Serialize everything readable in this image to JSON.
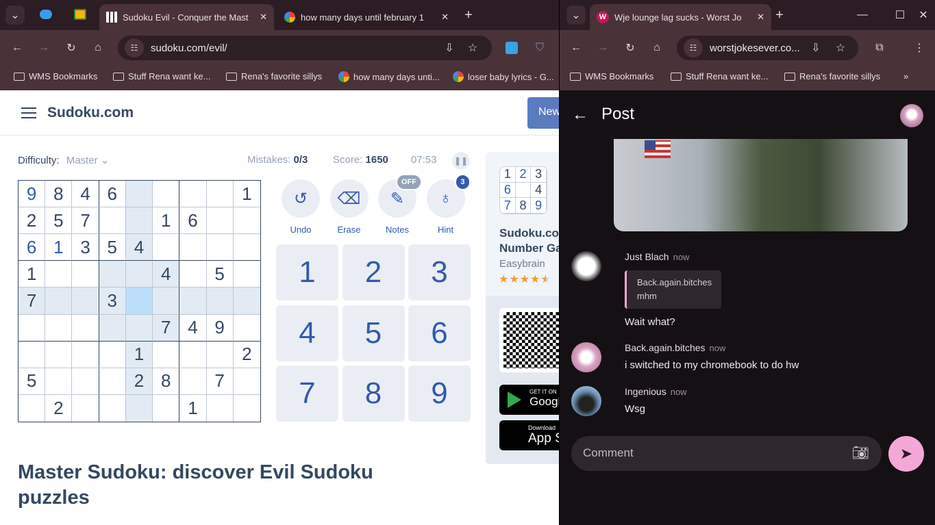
{
  "left_browser": {
    "tabs": [
      {
        "title": "Sudoku Evil - Conquer the Mast",
        "active": true
      },
      {
        "title": "how many days until february 1",
        "active": false
      }
    ],
    "url": "sudoku.com/evil/",
    "bookmarks": [
      "WMS Bookmarks",
      "Stuff Rena want ke...",
      "Rena's favorite sillys",
      "how many days unti...",
      "loser baby lyrics - G..."
    ]
  },
  "sudoku": {
    "logo": "Sudoku.com",
    "new_game": "New",
    "difficulty_label": "Difficulty:",
    "difficulty": "Master",
    "mistakes_label": "Mistakes:",
    "mistakes": "0/3",
    "score_label": "Score:",
    "score": "1650",
    "timer": "07:53",
    "grid": [
      [
        "9",
        "8",
        "4",
        "6",
        "",
        "",
        "",
        "",
        "1"
      ],
      [
        "2",
        "5",
        "7",
        "",
        "",
        "1",
        "6",
        "",
        ""
      ],
      [
        "6",
        "1",
        "3",
        "5",
        "4",
        "",
        "",
        "",
        ""
      ],
      [
        "1",
        "",
        "",
        "",
        "",
        "4",
        "",
        "5",
        ""
      ],
      [
        "7",
        "",
        "",
        "3",
        "",
        "",
        "",
        "",
        ""
      ],
      [
        "",
        "",
        "",
        "",
        "",
        "7",
        "4",
        "9",
        ""
      ],
      [
        "",
        "",
        "",
        "",
        "1",
        "",
        "",
        "",
        "2"
      ],
      [
        "5",
        "",
        "",
        "",
        "2",
        "8",
        "",
        "7",
        ""
      ],
      [
        "",
        "2",
        "",
        "",
        "",
        "",
        "1",
        "",
        ""
      ]
    ],
    "user_cells": [
      "0-0",
      "2-0",
      "2-1"
    ],
    "selected": "4-4",
    "actions": [
      {
        "label": "Undo",
        "icon": "undo-icon"
      },
      {
        "label": "Erase",
        "icon": "eraser-icon"
      },
      {
        "label": "Notes",
        "icon": "pencil-icon",
        "badge": "OFF"
      },
      {
        "label": "Hint",
        "icon": "lightbulb-icon",
        "badge": "3"
      }
    ],
    "numpad": [
      "1",
      "2",
      "3",
      "4",
      "5",
      "6",
      "7",
      "8",
      "9"
    ],
    "heading": "Master Sudoku: discover Evil Sudoku puzzles",
    "promo": {
      "icon_digits": [
        "1",
        "2",
        "3",
        "6",
        "",
        "4",
        "7",
        "8",
        "9"
      ],
      "title_line1": "Sudoku.co",
      "title_line2": "Number Ga",
      "publisher": "Easybrain",
      "rating": 4.5,
      "google_small": "GET IT ON",
      "google_big": "Googl",
      "apple_small": "Download",
      "apple_big": "App S"
    }
  },
  "right_browser": {
    "tab_title": "Wje lounge lag sucks - Worst Jo",
    "url": "worstjokesever.co...",
    "bookmarks": [
      "WMS Bookmarks",
      "Stuff Rena want ke...",
      "Rena's favorite sillys"
    ]
  },
  "post": {
    "title": "Post",
    "comments": [
      {
        "user": "Just Blach",
        "time": "now",
        "quote_user": "Back.again.bitches",
        "quote_text": "mhm",
        "text": "Wait what?"
      },
      {
        "user": "Back.again.bitches",
        "time": "now",
        "text": "i switched to my chromebook to do hw"
      },
      {
        "user": "Ingenious",
        "time": "now",
        "text": "Wsg"
      }
    ],
    "comment_placeholder": "Comment",
    "accent": "#f4a8d8"
  }
}
